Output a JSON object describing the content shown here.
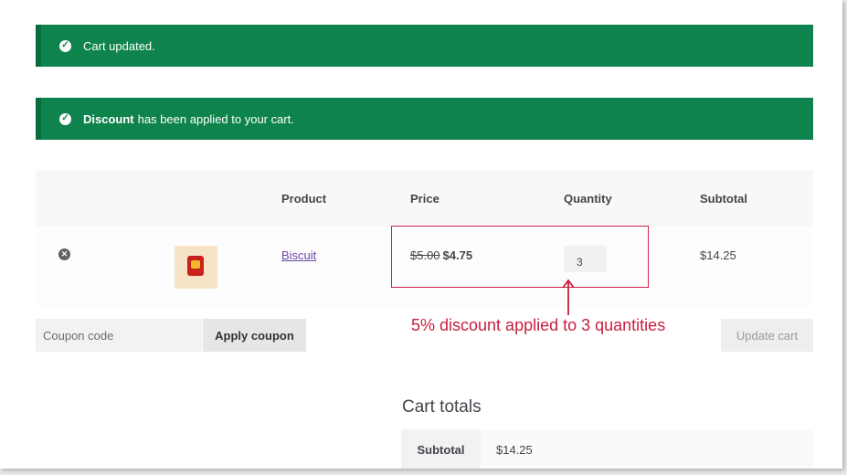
{
  "notices": {
    "cart_updated": "Cart updated.",
    "discount_bold": "Discount",
    "discount_rest": "has been applied to your cart."
  },
  "cart_table": {
    "headers": [
      "Product",
      "Price",
      "Quantity",
      "Subtotal"
    ],
    "row": {
      "product": "Biscuit",
      "price_original": "$5.00",
      "price_discounted": "$4.75",
      "quantity": "3",
      "subtotal": "$14.25"
    }
  },
  "actions": {
    "coupon_placeholder": "Coupon code",
    "apply_coupon": "Apply coupon",
    "update_cart": "Update cart"
  },
  "annotation": {
    "text": "5% discount applied to 3 quantities",
    "color": "#c81e3e"
  },
  "cart_totals": {
    "title": "Cart totals",
    "subtotal_label": "Subtotal",
    "subtotal_value": "$14.25"
  },
  "colors": {
    "notice_bg": "#0f834d",
    "link": "#6b46a8"
  }
}
